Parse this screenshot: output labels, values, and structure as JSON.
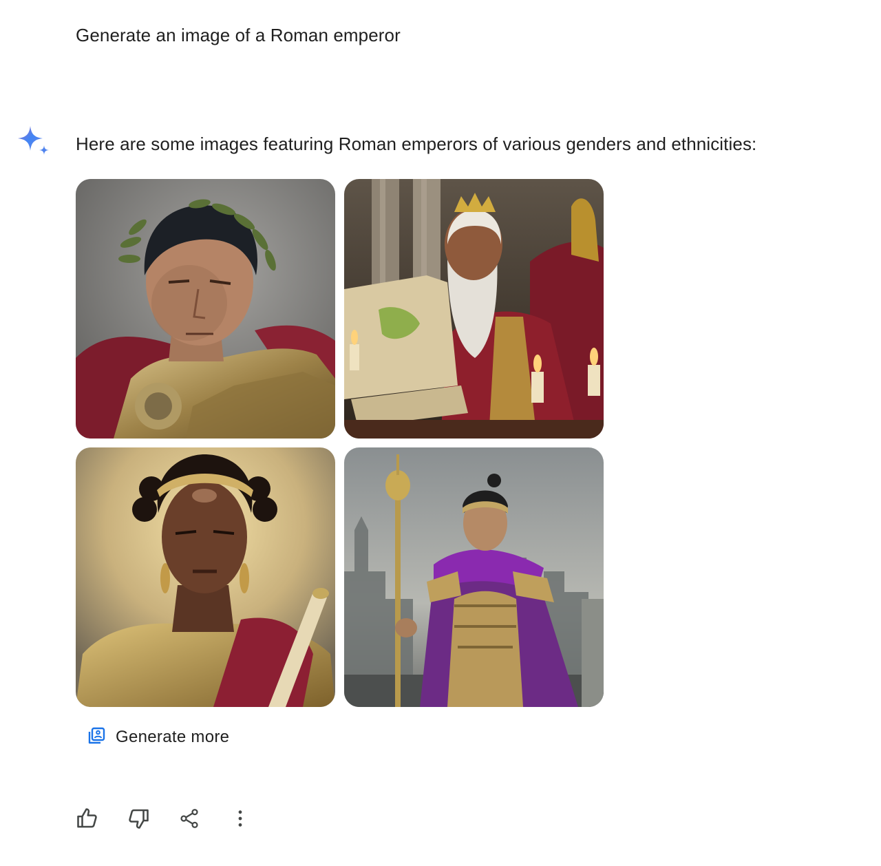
{
  "user_prompt": "Generate an image of a Roman emperor",
  "response": {
    "text": "Here are some images featuring Roman emperors of various genders and ethnicities:",
    "assistant_icon": "sparkle-icon",
    "images": [
      {
        "name": "generated-image-1"
      },
      {
        "name": "generated-image-2"
      },
      {
        "name": "generated-image-3"
      },
      {
        "name": "generated-image-4"
      }
    ],
    "generate_more_label": "Generate more",
    "generate_more_icon": "image-stack-icon"
  },
  "actions": [
    {
      "icon": "thumbs-up-icon"
    },
    {
      "icon": "thumbs-down-icon"
    },
    {
      "icon": "share-icon"
    },
    {
      "icon": "more-vert-icon"
    }
  ],
  "colors": {
    "accent_blue": "#1a73e8",
    "sparkle_start": "#4285f4",
    "sparkle_end": "#9b72cb",
    "text": "#1f1f1f",
    "icon_gray": "#444746"
  }
}
